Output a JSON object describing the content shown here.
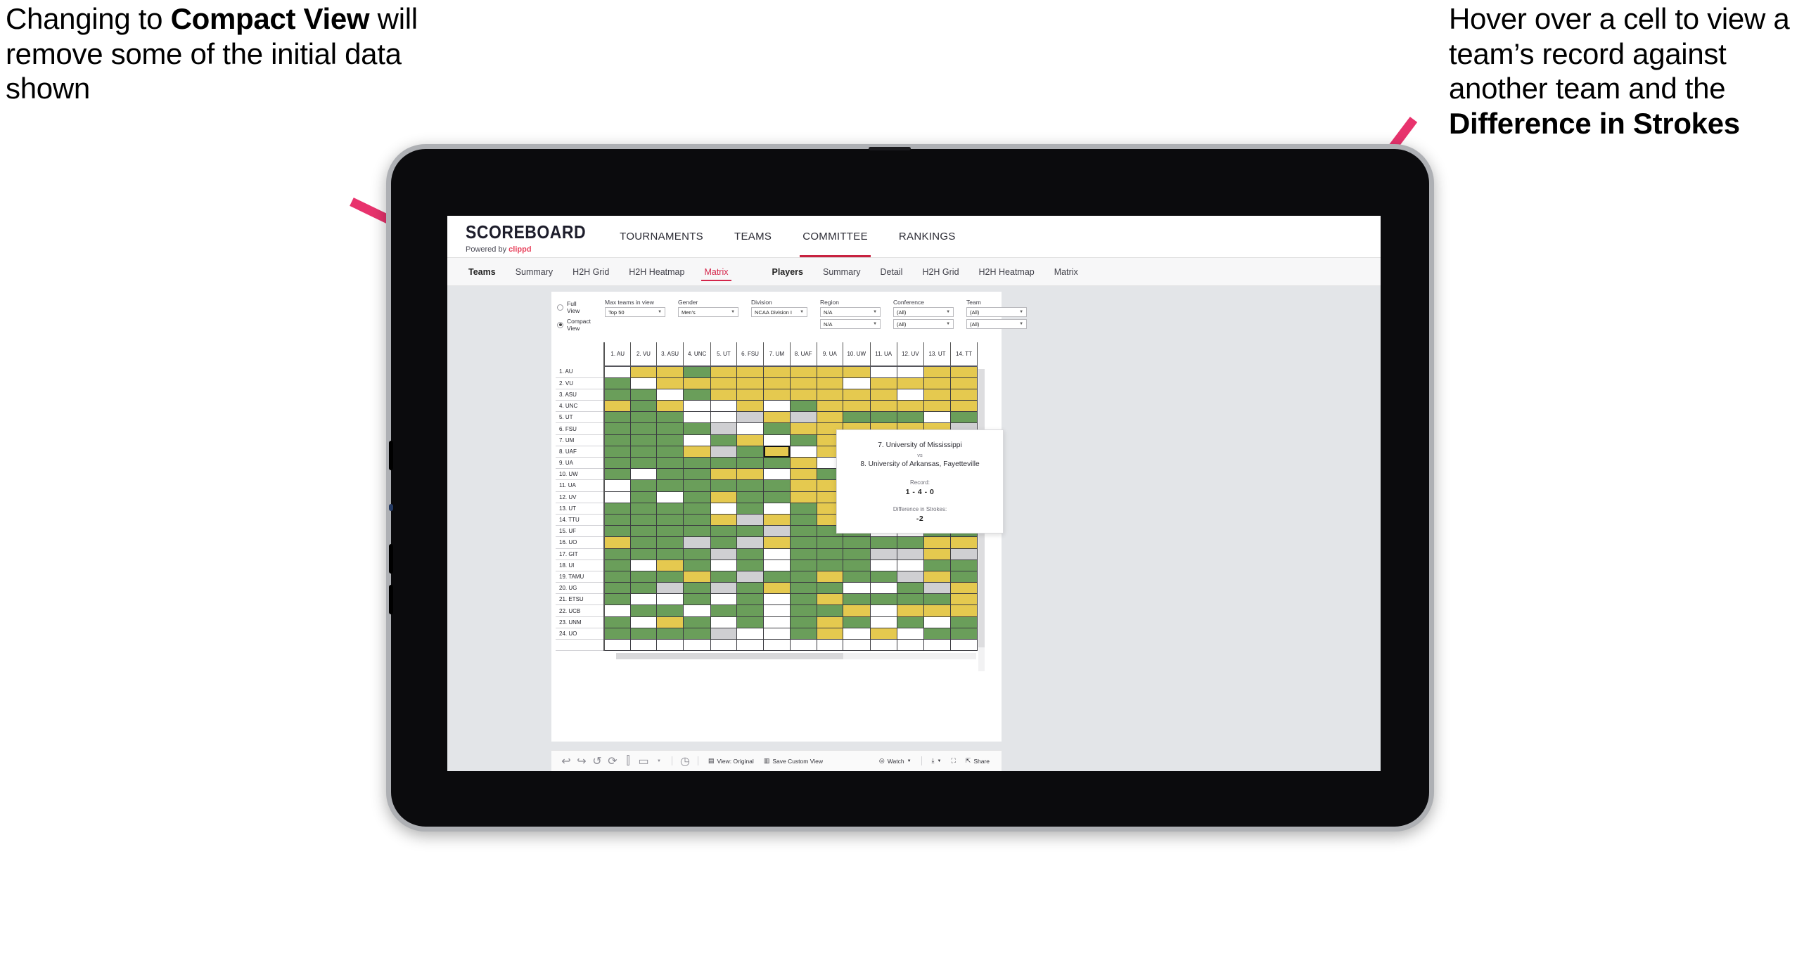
{
  "annotations": {
    "left": {
      "pre": "Changing to ",
      "bold": "Compact View",
      "post": " will remove some of the initial data shown"
    },
    "right": {
      "pre": "Hover over a cell to view a team’s record against another team and the ",
      "bold": "Difference in Strokes",
      "post": ""
    },
    "arrow_color": "#e8336d"
  },
  "app": {
    "brand": {
      "name": "SCOREBOARD",
      "powered_prefix": "Powered by ",
      "powered_name": "clippd"
    },
    "topnav": [
      {
        "label": "TOURNAMENTS",
        "active": false
      },
      {
        "label": "TEAMS",
        "active": false
      },
      {
        "label": "COMMITTEE",
        "active": true
      },
      {
        "label": "RANKINGS",
        "active": false
      }
    ],
    "subnav": [
      {
        "head": "Teams",
        "items": [
          {
            "label": "Summary",
            "active": false
          },
          {
            "label": "H2H Grid",
            "active": false
          },
          {
            "label": "H2H Heatmap",
            "active": false
          },
          {
            "label": "Matrix",
            "active": true
          }
        ]
      },
      {
        "head": "Players",
        "items": [
          {
            "label": "Summary",
            "active": false
          },
          {
            "label": "Detail",
            "active": false
          },
          {
            "label": "H2H Grid",
            "active": false
          },
          {
            "label": "H2H Heatmap",
            "active": false
          },
          {
            "label": "Matrix",
            "active": false
          }
        ]
      }
    ],
    "filters": {
      "view_modes": [
        {
          "label": "Full View",
          "selected": false
        },
        {
          "label": "Compact View",
          "selected": true
        }
      ],
      "selects": [
        {
          "label": "Max teams in view",
          "values": [
            "Top 50"
          ]
        },
        {
          "label": "Gender",
          "values": [
            "Men's"
          ]
        },
        {
          "label": "Division",
          "values": [
            "NCAA Division I"
          ]
        },
        {
          "label": "Region",
          "values": [
            "N/A",
            "N/A"
          ]
        },
        {
          "label": "Conference",
          "values": [
            "(All)",
            "(All)"
          ]
        },
        {
          "label": "Team",
          "values": [
            "(All)",
            "(All)"
          ]
        }
      ]
    },
    "toolbar": {
      "icons": [
        "undo-icon",
        "redo-icon",
        "revert-icon",
        "refresh-icon",
        "pause-icon",
        "zoom-icon"
      ],
      "clock_icon": "history-icon",
      "view_label": "View: Original",
      "save_label": "Save Custom View",
      "watch_label": "Watch",
      "download_icon": "download-icon",
      "fullscreen_icon": "fullscreen-icon",
      "share_label": "Share"
    },
    "tooltip": {
      "team_a": "7. University of Mississippi",
      "vs": "vs",
      "team_b": "8. University of Arkansas, Fayetteville",
      "record_label": "Record:",
      "record_value": "1 - 4 - 0",
      "strokes_label": "Difference in Strokes:",
      "strokes_value": "-2"
    }
  },
  "chart_data": {
    "type": "heatmap",
    "title": "Teams Matrix — Head to Head",
    "legend": {
      "position": "none"
    },
    "colors": {
      "win": "#6a9e5a",
      "loss": "#e5c94f",
      "tie": "#cfcfd2",
      "none": "#ffffff"
    },
    "columns": [
      "1. AU",
      "2. VU",
      "3. ASU",
      "4. UNC",
      "5. UT",
      "6. FSU",
      "7. UM",
      "8. UAF",
      "9. UA",
      "10. UW",
      "11. UA",
      "12. UV",
      "13. UT",
      "14. TT"
    ],
    "rows": [
      "1. AU",
      "2. VU",
      "3. ASU",
      "4. UNC",
      "5. UT",
      "6. FSU",
      "7. UM",
      "8. UAF",
      "9. UA",
      "10. UW",
      "11. UA",
      "12. UV",
      "13. UT",
      "14. TTU",
      "15. UF",
      "16. UO",
      "17. GIT",
      "18. UI",
      "19. TAMU",
      "20. UG",
      "21. ETSU",
      "22. UCB",
      "23. UNM",
      "24. UO"
    ],
    "selected_cell": {
      "row": "8. UAF",
      "col": "7. UM"
    },
    "matrix": [
      [
        "w",
        "y",
        "y",
        "g",
        "y",
        "y",
        "y",
        "y",
        "y",
        "y",
        "w",
        "w",
        "y",
        "y"
      ],
      [
        "g",
        "w",
        "y",
        "y",
        "y",
        "y",
        "y",
        "y",
        "y",
        "w",
        "y",
        "y",
        "y",
        "y"
      ],
      [
        "g",
        "g",
        "w",
        "g",
        "y",
        "y",
        "y",
        "y",
        "y",
        "y",
        "y",
        "w",
        "y",
        "y"
      ],
      [
        "y",
        "g",
        "y",
        "w",
        "w",
        "y",
        "w",
        "g",
        "y",
        "y",
        "y",
        "y",
        "y",
        "y"
      ],
      [
        "g",
        "g",
        "g",
        "w",
        "w",
        "a",
        "y",
        "a",
        "y",
        "g",
        "g",
        "g",
        "w",
        "g"
      ],
      [
        "g",
        "g",
        "g",
        "g",
        "a",
        "w",
        "g",
        "y",
        "y",
        "y",
        "y",
        "y",
        "y",
        "a"
      ],
      [
        "g",
        "g",
        "g",
        "w",
        "g",
        "y",
        "w",
        "g",
        "y",
        "y",
        "y",
        "g",
        "w",
        "g"
      ],
      [
        "g",
        "g",
        "g",
        "y",
        "a",
        "g",
        "y",
        "w",
        "y",
        "y",
        "y",
        "y",
        "y",
        "a"
      ],
      [
        "g",
        "g",
        "g",
        "g",
        "g",
        "g",
        "g",
        "y",
        "w",
        "g",
        "g",
        "y",
        "g",
        "y"
      ],
      [
        "g",
        "w",
        "g",
        "g",
        "y",
        "y",
        "w",
        "y",
        "g",
        "w",
        "g",
        "g",
        "y",
        "a"
      ],
      [
        "w",
        "g",
        "g",
        "g",
        "g",
        "g",
        "g",
        "y",
        "y",
        "w",
        "w",
        "g",
        "y",
        "y"
      ],
      [
        "w",
        "g",
        "w",
        "g",
        "y",
        "g",
        "g",
        "y",
        "y",
        "g",
        "w",
        "w",
        "w",
        "y"
      ],
      [
        "g",
        "g",
        "g",
        "g",
        "w",
        "g",
        "w",
        "g",
        "y",
        "y",
        "w",
        "w",
        "w",
        "w"
      ],
      [
        "g",
        "g",
        "g",
        "g",
        "y",
        "a",
        "y",
        "g",
        "y",
        "g",
        "w",
        "w",
        "g",
        "a"
      ],
      [
        "g",
        "g",
        "g",
        "g",
        "g",
        "g",
        "a",
        "g",
        "g",
        "g",
        "w",
        "w",
        "g",
        "g"
      ],
      [
        "y",
        "g",
        "g",
        "a",
        "g",
        "a",
        "y",
        "g",
        "g",
        "g",
        "g",
        "g",
        "y",
        "y"
      ],
      [
        "g",
        "g",
        "g",
        "g",
        "a",
        "g",
        "w",
        "g",
        "g",
        "g",
        "a",
        "a",
        "y",
        "a"
      ],
      [
        "g",
        "w",
        "y",
        "g",
        "w",
        "g",
        "w",
        "g",
        "g",
        "g",
        "w",
        "w",
        "g",
        "g"
      ],
      [
        "g",
        "g",
        "g",
        "y",
        "g",
        "a",
        "g",
        "g",
        "y",
        "g",
        "g",
        "a",
        "y",
        "g"
      ],
      [
        "g",
        "g",
        "a",
        "g",
        "a",
        "g",
        "y",
        "g",
        "g",
        "w",
        "w",
        "g",
        "a",
        "y"
      ],
      [
        "g",
        "w",
        "w",
        "g",
        "w",
        "g",
        "w",
        "g",
        "y",
        "g",
        "g",
        "g",
        "g",
        "y"
      ],
      [
        "w",
        "g",
        "g",
        "w",
        "g",
        "g",
        "w",
        "g",
        "g",
        "y",
        "w",
        "y",
        "y",
        "y"
      ],
      [
        "g",
        "w",
        "y",
        "g",
        "w",
        "g",
        "w",
        "g",
        "y",
        "g",
        "w",
        "g",
        "w",
        "g"
      ],
      [
        "g",
        "g",
        "g",
        "g",
        "a",
        "w",
        "w",
        "g",
        "y",
        "w",
        "y",
        "w",
        "g",
        "g"
      ]
    ]
  }
}
